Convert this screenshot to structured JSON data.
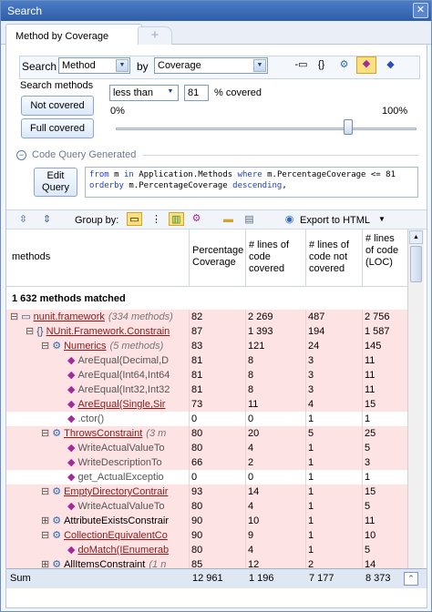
{
  "window": {
    "title": "Search",
    "close_glyph": "✕"
  },
  "tabs": [
    {
      "label": "Method by Coverage"
    },
    {
      "label": "+"
    }
  ],
  "search": {
    "label": "Search",
    "kind": "Method",
    "by_label": "by",
    "criterion": "Coverage"
  },
  "methods": {
    "label": "Search methods",
    "not_covered": "Not covered",
    "full_covered": "Full covered",
    "comparator": "less than",
    "value": "81",
    "unit": "% covered",
    "min": "0%",
    "max": "100%",
    "slider_value": 81
  },
  "query": {
    "section": "Code Query Generated",
    "edit_button": "Edit\nQuery",
    "line1_kw1": "from",
    "line1_t1": " m ",
    "line1_kw2": "in",
    "line1_t2": " Application.Methods ",
    "line1_kw3": "where",
    "line1_t3": " m.PercentageCoverage <= 81",
    "line2_kw": "orderby",
    "line2_t": " m.PercentageCoverage ",
    "line2_kw2": "descending",
    "line2_t2": ","
  },
  "toolbar": {
    "group_by": "Group by:",
    "export": "Export to HTML"
  },
  "columns": [
    "methods",
    "Percentage Coverage",
    "# lines of code covered",
    "# lines of code not covered",
    "# lines of code (LOC)"
  ],
  "matched": "1 632 methods matched",
  "rows": [
    {
      "indent": 0,
      "exp": "⊟",
      "icon": "▭",
      "name": "nunit.framework",
      "note": "(334 methods)",
      "c": [
        "82",
        "2 269",
        "487",
        "2 756"
      ],
      "bg": "#fde3e3",
      "link": true
    },
    {
      "indent": 1,
      "exp": "⊟",
      "icon": "{}",
      "name": "NUnit.Framework.Constrain",
      "note": "",
      "c": [
        "87",
        "1 393",
        "194",
        "1 587"
      ],
      "bg": "#fde3e3",
      "link": true
    },
    {
      "indent": 2,
      "exp": "⊟",
      "icon": "⚙",
      "name": "Numerics",
      "note": "(5 methods)",
      "c": [
        "83",
        "121",
        "24",
        "145"
      ],
      "bg": "#fde3e3",
      "link": true
    },
    {
      "indent": 3,
      "exp": "",
      "icon": "◆",
      "name": "AreEqual(Decimal,D",
      "note": "",
      "c": [
        "81",
        "8",
        "3",
        "11"
      ],
      "bg": "#fde3e3",
      "link": false
    },
    {
      "indent": 3,
      "exp": "",
      "icon": "◆",
      "name": "AreEqual(Int64,Int64",
      "note": "",
      "c": [
        "81",
        "8",
        "3",
        "11"
      ],
      "bg": "#fde3e3",
      "link": false
    },
    {
      "indent": 3,
      "exp": "",
      "icon": "◆",
      "name": "AreEqual(Int32,Int32",
      "note": "",
      "c": [
        "81",
        "8",
        "3",
        "11"
      ],
      "bg": "#fde3e3",
      "link": false
    },
    {
      "indent": 3,
      "exp": "",
      "icon": "◆",
      "name": "AreEqual(Single,Sir",
      "note": "",
      "c": [
        "73",
        "11",
        "4",
        "15"
      ],
      "bg": "#fde3e3",
      "link": true
    },
    {
      "indent": 3,
      "exp": "",
      "icon": "◆",
      "name": ".ctor()",
      "note": "",
      "c": [
        "0",
        "0",
        "1",
        "1"
      ],
      "bg": "#fff",
      "link": false
    },
    {
      "indent": 2,
      "exp": "⊟",
      "icon": "⚙",
      "name": "ThrowsConstraint",
      "note": "(3 m",
      "c": [
        "80",
        "20",
        "5",
        "25"
      ],
      "bg": "#fde3e3",
      "link": true
    },
    {
      "indent": 3,
      "exp": "",
      "icon": "◆",
      "name": "WriteActualValueTo",
      "note": "",
      "c": [
        "80",
        "4",
        "1",
        "5"
      ],
      "bg": "#fde3e3",
      "link": false
    },
    {
      "indent": 3,
      "exp": "",
      "icon": "◆",
      "name": "WriteDescriptionTo",
      "note": "",
      "c": [
        "66",
        "2",
        "1",
        "3"
      ],
      "bg": "#fde3e3",
      "link": false
    },
    {
      "indent": 3,
      "exp": "",
      "icon": "◆",
      "name": "get_ActualExceptio",
      "note": "",
      "c": [
        "0",
        "0",
        "1",
        "1"
      ],
      "bg": "#fff",
      "link": false
    },
    {
      "indent": 2,
      "exp": "⊟",
      "icon": "⚙",
      "name": "EmptyDirectoryContrair",
      "note": "",
      "c": [
        "93",
        "14",
        "1",
        "15"
      ],
      "bg": "#fde3e3",
      "link": true
    },
    {
      "indent": 3,
      "exp": "",
      "icon": "◆",
      "name": "WriteActualValueTo",
      "note": "",
      "c": [
        "80",
        "4",
        "1",
        "5"
      ],
      "bg": "#fde3e3",
      "link": false
    },
    {
      "indent": 2,
      "exp": "⊞",
      "icon": "⚙",
      "name": "AttributeExistsConstrair",
      "note": "",
      "c": [
        "90",
        "10",
        "1",
        "11"
      ],
      "bg": "#fde3e3",
      "link": false
    },
    {
      "indent": 2,
      "exp": "⊟",
      "icon": "⚙",
      "name": "CollectionEquivalentCo",
      "note": "",
      "c": [
        "90",
        "9",
        "1",
        "10"
      ],
      "bg": "#fde3e3",
      "link": true
    },
    {
      "indent": 3,
      "exp": "",
      "icon": "◆",
      "name": "doMatch(IEnumerab",
      "note": "",
      "c": [
        "80",
        "4",
        "1",
        "5"
      ],
      "bg": "#fde3e3",
      "link": true
    },
    {
      "indent": 2,
      "exp": "⊞",
      "icon": "⚙",
      "name": "AllItemsConstraint",
      "note": "(1 n",
      "c": [
        "85",
        "12",
        "2",
        "14"
      ],
      "bg": "#fde3e3",
      "link": false
    }
  ],
  "sum": {
    "label": "Sum",
    "c": [
      "12 961",
      "1 196",
      "7 177",
      "8 373"
    ]
  }
}
